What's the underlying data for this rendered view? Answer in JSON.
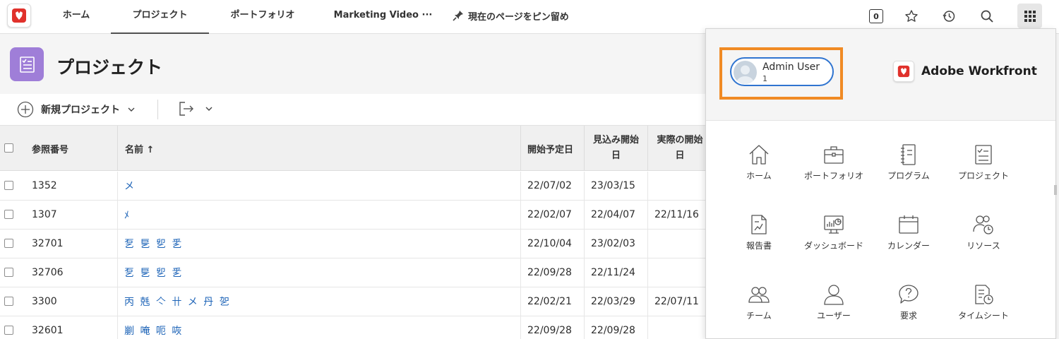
{
  "topbar": {
    "tabs": [
      {
        "label": "ホーム",
        "active": false
      },
      {
        "label": "プロジェクト",
        "active": true
      },
      {
        "label": "ポートフォリオ",
        "active": false
      },
      {
        "label": "Marketing Video ···",
        "active": false
      }
    ],
    "pin_label": "現在のページをピン留め",
    "notification_count": "0",
    "icons": [
      "star-icon",
      "history-icon",
      "search-icon",
      "app-grid-icon"
    ]
  },
  "page": {
    "title": "プロジェクト",
    "new_project_label": "新規プロジェクト"
  },
  "table": {
    "headers": {
      "ref": "参照番号",
      "name": "名前 ↑",
      "planned_start": "開始予定日",
      "projected_start_line1": "見込み開始",
      "projected_start_line2": "日",
      "actual_start_line1": "実際の開始",
      "actual_start_line2": "日"
    },
    "rows": [
      {
        "ref": "1352",
        "name": "メ",
        "planned": "22/07/02",
        "projected": "23/03/15",
        "actual": ""
      },
      {
        "ref": "1307",
        "name": "ﾒ",
        "planned": "22/02/07",
        "projected": "22/04/07",
        "actual": "22/11/16"
      },
      {
        "ref": "32701",
        "name": "乭 乬 乮 乯",
        "planned": "22/10/04",
        "projected": "23/02/03",
        "actual": ""
      },
      {
        "ref": "32706",
        "name": "乭 乬 乮 乯",
        "planned": "22/09/28",
        "projected": "22/11/24",
        "actual": ""
      },
      {
        "ref": "3300",
        "name": "丙 兞 亽 卄 メ 丹 乫",
        "planned": "22/02/21",
        "projected": "22/03/29",
        "actual": "22/07/11"
      },
      {
        "ref": "32601",
        "name": "剻 唵 呃 咴",
        "planned": "22/09/28",
        "projected": "22/09/28",
        "actual": ""
      }
    ]
  },
  "panel": {
    "user_name": "Admin User",
    "user_sub": "1",
    "brand": "Adobe Workfront",
    "apps": [
      {
        "label": "ホーム",
        "icon": "home-icon"
      },
      {
        "label": "ポートフォリオ",
        "icon": "portfolio-icon"
      },
      {
        "label": "プログラム",
        "icon": "program-icon"
      },
      {
        "label": "プロジェクト",
        "icon": "project-icon"
      },
      {
        "label": "報告書",
        "icon": "report-icon"
      },
      {
        "label": "ダッシュボード",
        "icon": "dashboard-icon"
      },
      {
        "label": "カレンダー",
        "icon": "calendar-icon"
      },
      {
        "label": "リソース",
        "icon": "resource-icon"
      },
      {
        "label": "チーム",
        "icon": "team-icon"
      },
      {
        "label": "ユーザー",
        "icon": "user-icon"
      },
      {
        "label": "要求",
        "icon": "request-icon"
      },
      {
        "label": "タイムシート",
        "icon": "timesheet-icon"
      }
    ]
  },
  "colors": {
    "accent_orange": "#f08a24",
    "link_blue": "#1c63b7",
    "project_purple": "#9f7ed8",
    "user_pill_blue": "#2f74d0",
    "brand_red": "#e0312b"
  }
}
